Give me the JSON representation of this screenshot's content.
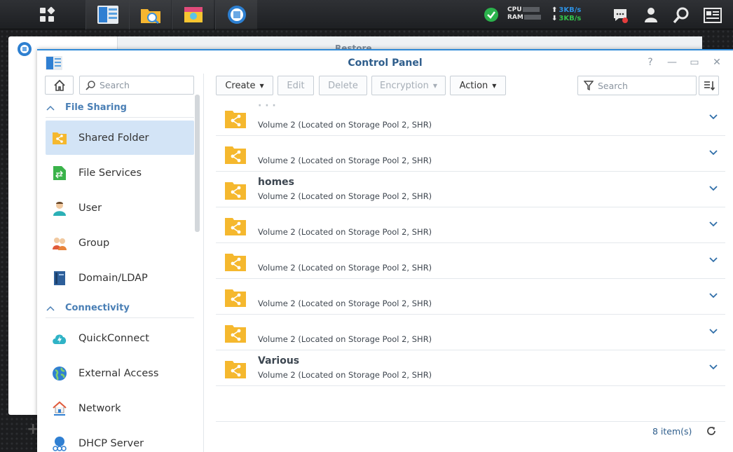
{
  "taskbar": {
    "apps": [
      "main-menu",
      "control-panel",
      "file-station",
      "package-center",
      "hyper-backup"
    ],
    "cpu_label": "CPU",
    "ram_label": "RAM",
    "upload_speed": "3KB/s",
    "download_speed": "3KB/s",
    "upload_arrow": "⬆",
    "download_arrow": "⬇"
  },
  "background_window": {
    "title": "Restore"
  },
  "window": {
    "title": "Control Panel",
    "help": "?",
    "minimize": "—",
    "maximize": "▭",
    "close": "✕"
  },
  "sidebar": {
    "search_placeholder": "Search",
    "sections": [
      {
        "label": "File Sharing",
        "items": [
          {
            "label": "Shared Folder",
            "icon": "shared-folder-icon",
            "active": true
          },
          {
            "label": "File Services",
            "icon": "file-services-icon"
          },
          {
            "label": "User",
            "icon": "user-icon"
          },
          {
            "label": "Group",
            "icon": "group-icon"
          },
          {
            "label": "Domain/LDAP",
            "icon": "domain-ldap-icon"
          }
        ]
      },
      {
        "label": "Connectivity",
        "items": [
          {
            "label": "QuickConnect",
            "icon": "quickconnect-icon"
          },
          {
            "label": "External Access",
            "icon": "external-access-icon"
          },
          {
            "label": "Network",
            "icon": "network-icon"
          },
          {
            "label": "DHCP Server",
            "icon": "dhcp-server-icon"
          }
        ]
      }
    ]
  },
  "toolbar": {
    "create": "Create",
    "edit": "Edit",
    "delete": "Delete",
    "encryption": "Encryption",
    "action": "Action",
    "search_placeholder": "Search"
  },
  "folders": [
    {
      "name": "· · ·",
      "location": "Volume 2 (Located on Storage Pool 2, SHR)"
    },
    {
      "name": "",
      "location": "Volume 2 (Located on Storage Pool 2, SHR)"
    },
    {
      "name": "homes",
      "location": "Volume 2 (Located on Storage Pool 2, SHR)"
    },
    {
      "name": "",
      "location": "Volume 2 (Located on Storage Pool 2, SHR)"
    },
    {
      "name": "",
      "location": "Volume 2 (Located on Storage Pool 2, SHR)"
    },
    {
      "name": "",
      "location": "Volume 2 (Located on Storage Pool 2, SHR)"
    },
    {
      "name": "",
      "location": "Volume 2 (Located on Storage Pool 2, SHR)"
    },
    {
      "name": "Various",
      "location": "Volume 2 (Located on Storage Pool 2, SHR)"
    }
  ],
  "footer": {
    "item_count": "8 item(s)"
  },
  "colors": {
    "accent": "#2f8ad8",
    "folder": "#f5b82e",
    "section": "#4a7fb5",
    "active_bg": "#d3e4f6"
  }
}
